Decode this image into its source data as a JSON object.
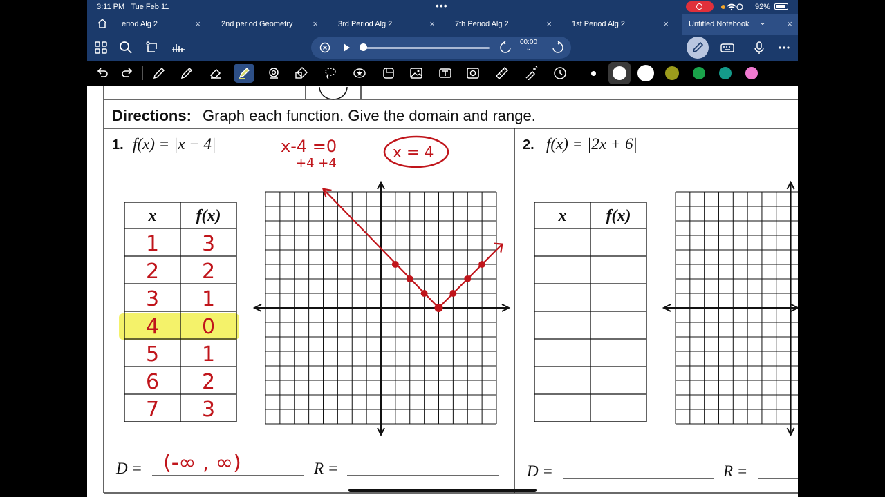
{
  "status": {
    "time": "3:11 PM",
    "date": "Tue Feb 11",
    "battery": "92%"
  },
  "tabs": [
    {
      "label": "eriod Alg 2",
      "active": false
    },
    {
      "label": "2nd period Geometry",
      "active": false
    },
    {
      "label": "3rd Period Alg 2",
      "active": false
    },
    {
      "label": "7th Period Alg 2",
      "active": false
    },
    {
      "label": "1st Period Alg 2",
      "active": false
    },
    {
      "label": "Untitled Notebook",
      "active": true
    }
  ],
  "tab_close": "×",
  "active_chevron": "⌄",
  "player": {
    "time": "00:00"
  },
  "ink_colors": [
    "#ffffff",
    "#ffffff",
    "#9b9b1c",
    "#1aa34a",
    "#149a8a",
    "#f07ad0"
  ],
  "worksheet": {
    "directions_label": "Directions:",
    "directions_text": "Graph each function.  Give the domain and range.",
    "problems": [
      {
        "number": "1.",
        "function": "f(x) = |x − 4|",
        "work": {
          "line1": "x-4 =0",
          "line2": "+4   +4",
          "answer": "x = 4"
        },
        "table_headers": [
          "x",
          "f(x)"
        ],
        "rows": [
          [
            "1",
            "3"
          ],
          [
            "2",
            "2"
          ],
          [
            "3",
            "1"
          ],
          [
            "4",
            "0"
          ],
          [
            "5",
            "1"
          ],
          [
            "6",
            "2"
          ],
          [
            "7",
            "3"
          ]
        ],
        "highlighted_row": 3,
        "domain_label": "D =",
        "domain": "(-∞ , ∞)",
        "range_label": "R =",
        "plotted_points": [
          [
            1,
            3
          ],
          [
            2,
            2
          ],
          [
            3,
            1
          ],
          [
            4,
            0
          ],
          [
            5,
            1
          ],
          [
            6,
            2
          ],
          [
            7,
            3
          ]
        ],
        "graph_x_range": [
          -8,
          8
        ],
        "graph_y_range": [
          -8,
          8
        ]
      },
      {
        "number": "2.",
        "function": "f(x) = |2x + 6|",
        "table_headers": [
          "x",
          "f(x)"
        ],
        "row_count": 7,
        "domain_label": "D =",
        "range_label": "R ="
      }
    ]
  },
  "accent": {
    "ink_red": "#c0151b",
    "highlight": "#f3f15a",
    "chrome": "#1b3a6b"
  }
}
